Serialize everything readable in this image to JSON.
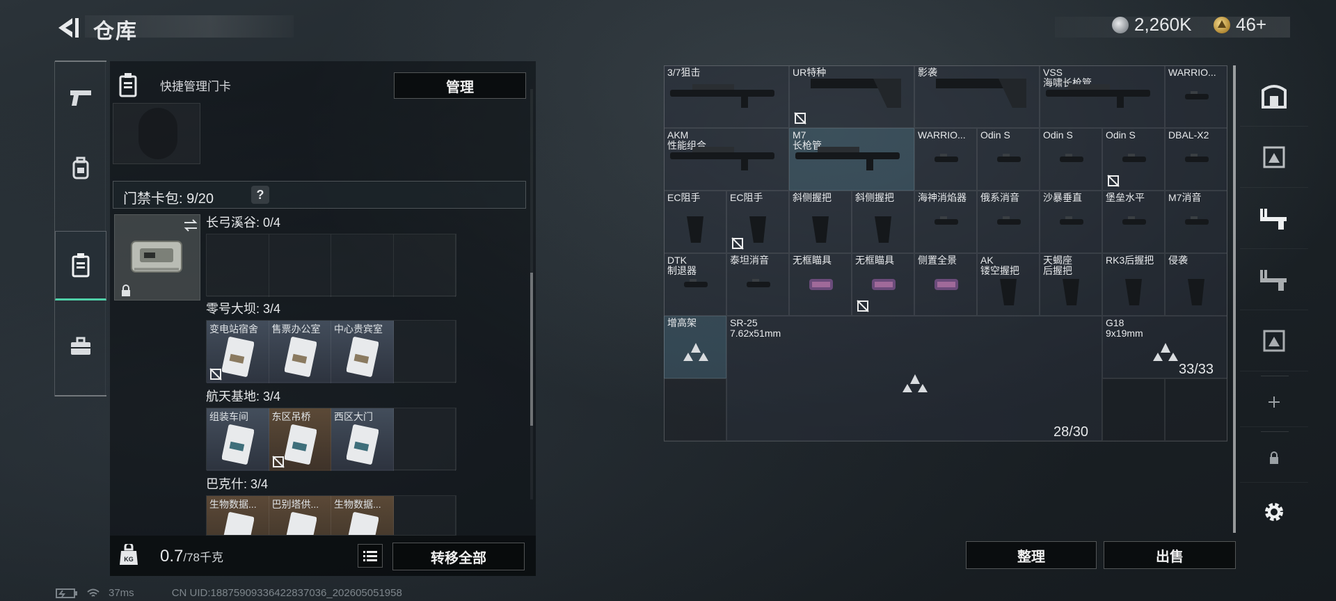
{
  "header": {
    "title": "仓库"
  },
  "currency": {
    "silver": "2,260K",
    "gold": "46+"
  },
  "left_panel": {
    "quick_manage_label": "快捷管理门卡",
    "manage_button": "管理",
    "keycase_label": "门禁卡包:",
    "keycase_count": "9/20",
    "help": "?",
    "maps": [
      {
        "name": "长弓溪谷:",
        "count": "0/4",
        "cards": [
          "",
          "",
          "",
          ""
        ]
      },
      {
        "name": "零号大坝:",
        "count": "3/4",
        "cards": [
          "变电站宿舍",
          "售票办公室",
          "中心贵宾室",
          ""
        ]
      },
      {
        "name": "航天基地:",
        "count": "3/4",
        "cards": [
          "组装车间",
          "东区吊桥",
          "西区大门",
          ""
        ]
      },
      {
        "name": "巴克什:",
        "count": "3/4",
        "cards": [
          "生物数据...",
          "巴别塔供...",
          "生物数据...",
          ""
        ]
      }
    ],
    "weight_value": "0.7",
    "weight_max": "/78千克",
    "list_icon": "list-icon",
    "transfer_all_button": "转移全部"
  },
  "stash": {
    "items": [
      {
        "label": "3/7狙击"
      },
      {
        "label": "UR特种"
      },
      {
        "label": "影袭"
      },
      {
        "label": "VSS\n海啸长枪管"
      },
      {
        "label": "WARRIO..."
      },
      {
        "label": "AKM\n性能组合"
      },
      {
        "label": "M7\n长枪管"
      },
      {
        "label": "WARRIO..."
      },
      {
        "label": "Odin S"
      },
      {
        "label": "Odin S"
      },
      {
        "label": "Odin S"
      },
      {
        "label": "DBAL-X2"
      },
      {
        "label": "EC阻手"
      },
      {
        "label": "EC阻手"
      },
      {
        "label": "斜侧握把"
      },
      {
        "label": "斜侧握把"
      },
      {
        "label": "海神消焰器"
      },
      {
        "label": "俄系消音"
      },
      {
        "label": "沙暴垂直"
      },
      {
        "label": "堡垒水平"
      },
      {
        "label": "M7消音"
      },
      {
        "label": "DTK\n制退器"
      },
      {
        "label": "泰坦消音"
      },
      {
        "label": "无框瞄具"
      },
      {
        "label": "无框瞄具"
      },
      {
        "label": "侧置全景"
      },
      {
        "label": "AK\n镂空握把"
      },
      {
        "label": "天蝎座\n后握把"
      },
      {
        "label": "RK3后握把"
      },
      {
        "label": "侵袭"
      },
      {
        "label": "增高架"
      },
      {
        "label": "SR-25\n7.62x51mm"
      },
      {
        "label": "G18\n9x19mm"
      }
    ],
    "ammo_sr25_count": "28/30",
    "ammo_g18_count": "33/33",
    "organize_button": "整理",
    "sell_button": "出售"
  },
  "status": {
    "ping": "37ms",
    "uid": "CN UID:18875909336422837036_202605051958"
  }
}
